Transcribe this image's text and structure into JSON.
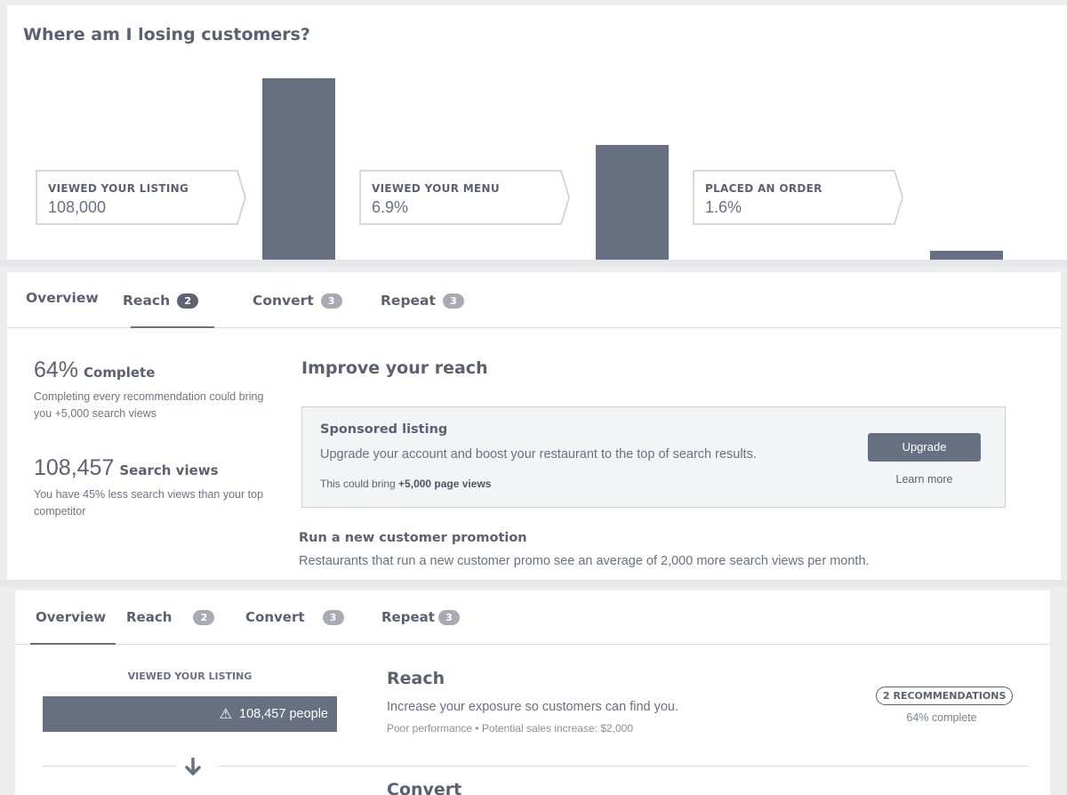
{
  "funnel": {
    "title": "Where am I losing customers?",
    "stages": [
      {
        "label": "VIEWED YOUR LISTING",
        "value": "108,000"
      },
      {
        "label": "VIEWED YOUR MENU",
        "value": "6.9%"
      },
      {
        "label": "PLACED AN ORDER",
        "value": "1.6%"
      }
    ]
  },
  "chart_data": {
    "type": "bar",
    "title": "Where am I losing customers?",
    "categories": [
      "VIEWED YOUR LISTING",
      "VIEWED YOUR MENU",
      "PLACED AN ORDER"
    ],
    "values": [
      100,
      60,
      5
    ],
    "note": "relative bar heights; bars cropped at bottom"
  },
  "reach_panel": {
    "tabs": [
      {
        "label": "Overview",
        "badge": ""
      },
      {
        "label": "Reach",
        "badge": "2"
      },
      {
        "label": "Convert",
        "badge": "3"
      },
      {
        "label": "Repeat",
        "badge": "3"
      }
    ],
    "active_tab": "Reach",
    "complete": {
      "value": "64%",
      "label": "Complete",
      "desc": "Completing every recommendation could bring you +5,000 search views"
    },
    "search_views": {
      "value": "108,457",
      "label": "Search views",
      "desc": "You have 45% less search views than your top competitor"
    },
    "section_title": "Improve your reach",
    "sponsored": {
      "title": "Sponsored listing",
      "desc": "Upgrade your account and boost your restaurant to the top of search results.",
      "note_prefix": "This could bring ",
      "note_strong": "+5,000 page views",
      "button": "Upgrade",
      "link": "Learn more"
    },
    "promo": {
      "title": "Run a new customer promotion",
      "desc": "Restaurants that run a new customer promo see an average of 2,000 more search views per month."
    }
  },
  "overview_panel": {
    "tabs": [
      {
        "label": "Overview",
        "badge": ""
      },
      {
        "label": "Reach",
        "badge": "2"
      },
      {
        "label": "Convert",
        "badge": "3"
      },
      {
        "label": "Repeat",
        "badge": "3"
      }
    ],
    "active_tab": "Overview",
    "funnel_label": "VIEWED YOUR LISTING",
    "funnel_value": "108,457 people",
    "reach": {
      "title": "Reach",
      "desc": "Increase your exposure so customers can find you.",
      "note": "Poor performance • Potential sales increase: $2,000",
      "recommendations": "2 RECOMMENDATIONS",
      "percent": "64% complete"
    },
    "next_title": "Convert"
  },
  "colors": {
    "accent": "#667081",
    "text": "#5b6170",
    "badge": "#a6abb4"
  }
}
